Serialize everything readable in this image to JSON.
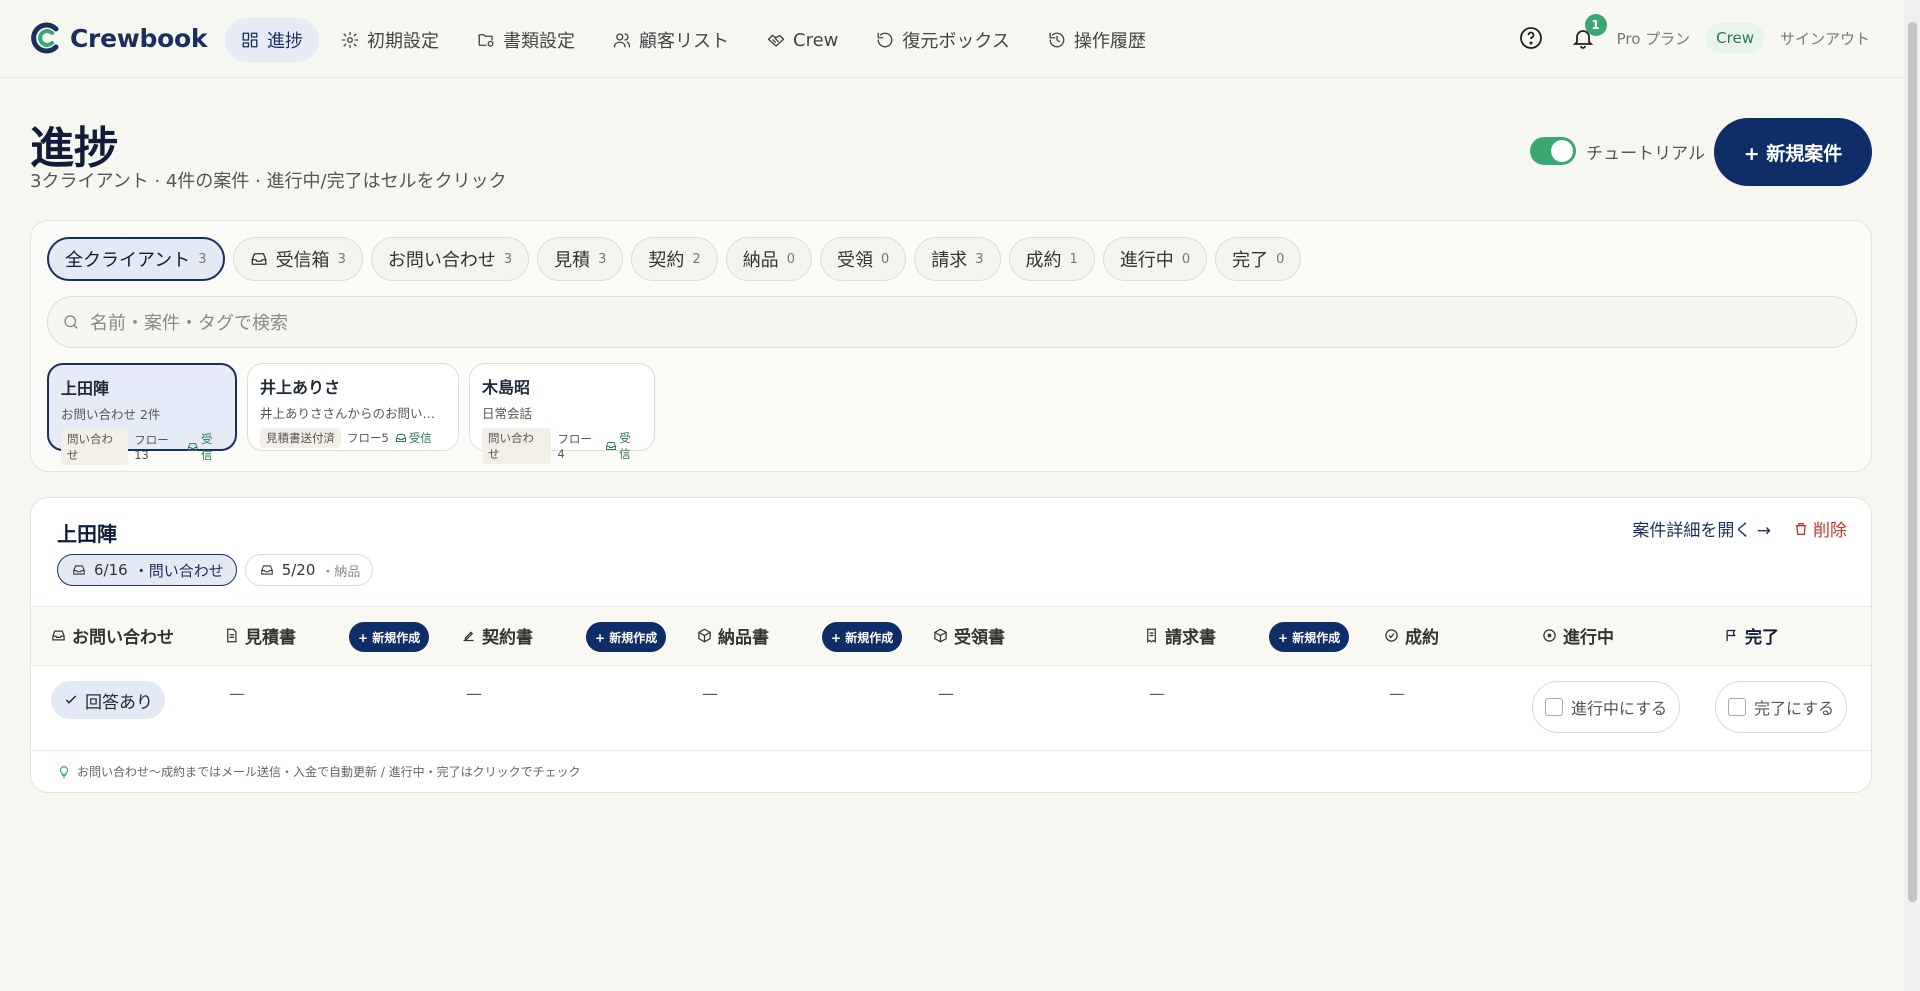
{
  "app": {
    "name": "Crewbook"
  },
  "nav": {
    "items": [
      {
        "label": "進捗",
        "icon": "dashboard-icon"
      },
      {
        "label": "初期設定",
        "icon": "gear-icon"
      },
      {
        "label": "書類設定",
        "icon": "folder-settings-icon"
      },
      {
        "label": "顧客リスト",
        "icon": "users-icon"
      },
      {
        "label": "Crew",
        "icon": "handshake-icon"
      },
      {
        "label": "復元ボックス",
        "icon": "restore-icon"
      },
      {
        "label": "操作履歴",
        "icon": "history-icon"
      }
    ],
    "notification_count": "1",
    "plan": "Pro プラン",
    "crew_badge": "Crew",
    "signout": "サインアウト"
  },
  "header": {
    "title": "進捗",
    "subtitle": "3クライアント · 4件の案件 · 進行中/完了はセルをクリック",
    "tutorial_label": "チュートリアル",
    "new_case_button": "+ 新規案件"
  },
  "filters": {
    "chips": [
      {
        "label": "全クライアント",
        "count": "3"
      },
      {
        "label": "受信箱",
        "count": "3"
      },
      {
        "label": "お問い合わせ",
        "count": "3"
      },
      {
        "label": "見積",
        "count": "3"
      },
      {
        "label": "契約",
        "count": "2"
      },
      {
        "label": "納品",
        "count": "0"
      },
      {
        "label": "受領",
        "count": "0"
      },
      {
        "label": "請求",
        "count": "3"
      },
      {
        "label": "成約",
        "count": "1"
      },
      {
        "label": "進行中",
        "count": "0"
      },
      {
        "label": "完了",
        "count": "0"
      }
    ],
    "search_placeholder": "名前・案件・タグで検索"
  },
  "clients": [
    {
      "name": "上田陣",
      "desc": "お問い合わせ 2件",
      "tag": "問い合わせ",
      "flow": "フロー13",
      "recv": "受信"
    },
    {
      "name": "井上ありさ",
      "desc": "井上ありささんからのお問い合...",
      "tag": "見積書送付済",
      "flow": "フロー5",
      "recv": "受信"
    },
    {
      "name": "木島昭",
      "desc": "日常会話",
      "tag": "問い合わせ",
      "flow": "フロー4",
      "recv": "受信"
    }
  ],
  "detail": {
    "client_name": "上田陣",
    "deals": [
      {
        "date": "6/16",
        "stage": "・問い合わせ"
      },
      {
        "date": "5/20",
        "stage": "・納品"
      }
    ],
    "open_link": "案件詳細を開く →",
    "delete_label": "削除",
    "columns": {
      "inquiry": "お問い合わせ",
      "estimate": "見積書",
      "contract": "契約書",
      "delivery": "納品書",
      "receipt": "受領書",
      "invoice": "請求書",
      "closed": "成約",
      "in_progress": "進行中",
      "done": "完了"
    },
    "new_create": "+ 新規作成",
    "answered": "回答あり",
    "dash": "—",
    "mark_in_progress": "進行中にする",
    "mark_done": "完了にする",
    "footnote": "お問い合わせ〜成約まではメール送信・入金で自動更新 / 進行中・完了はクリックでチェック"
  },
  "colors": {
    "brand": "#0f2d66",
    "accent": "#3aa874",
    "danger": "#c0392b"
  }
}
